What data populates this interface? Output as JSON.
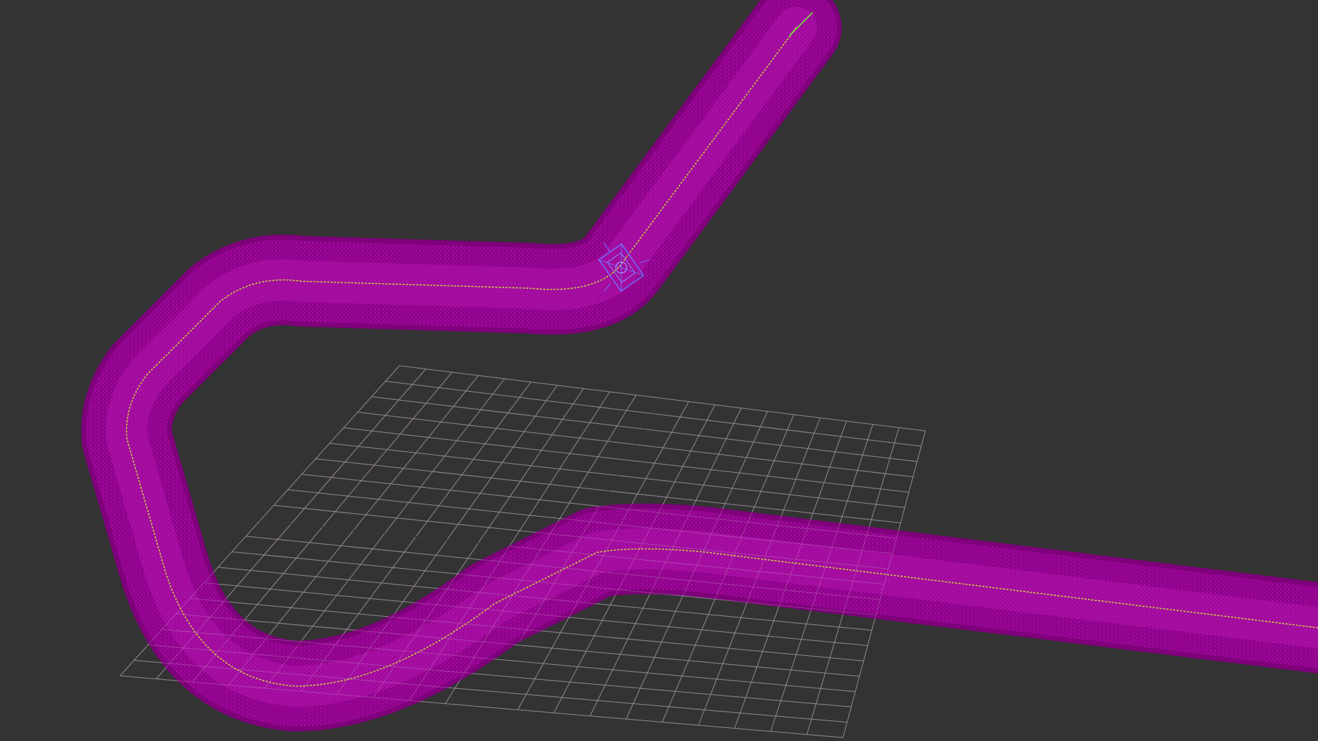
{
  "viewport": {
    "view": "perspective",
    "shading": "wireframe",
    "background_color": "#333333"
  },
  "colors": {
    "grid_line": "#7a7a7a",
    "grid_axis": "#111111",
    "tube_wire": "#a0009c",
    "tube_fill": "#8e008a",
    "spline_path": "#c8d23c",
    "object_gizmo": "#7070ff",
    "pivot_axis": "#6aff2a"
  },
  "scene_objects": [
    {
      "name": "home-grid",
      "kind": "grid",
      "selected": false
    },
    {
      "name": "path-spline",
      "kind": "spline",
      "selected": false
    },
    {
      "name": "sweep-tube",
      "kind": "mesh",
      "selected": true
    },
    {
      "name": "path-follower",
      "kind": "helper",
      "selected": false
    }
  ]
}
